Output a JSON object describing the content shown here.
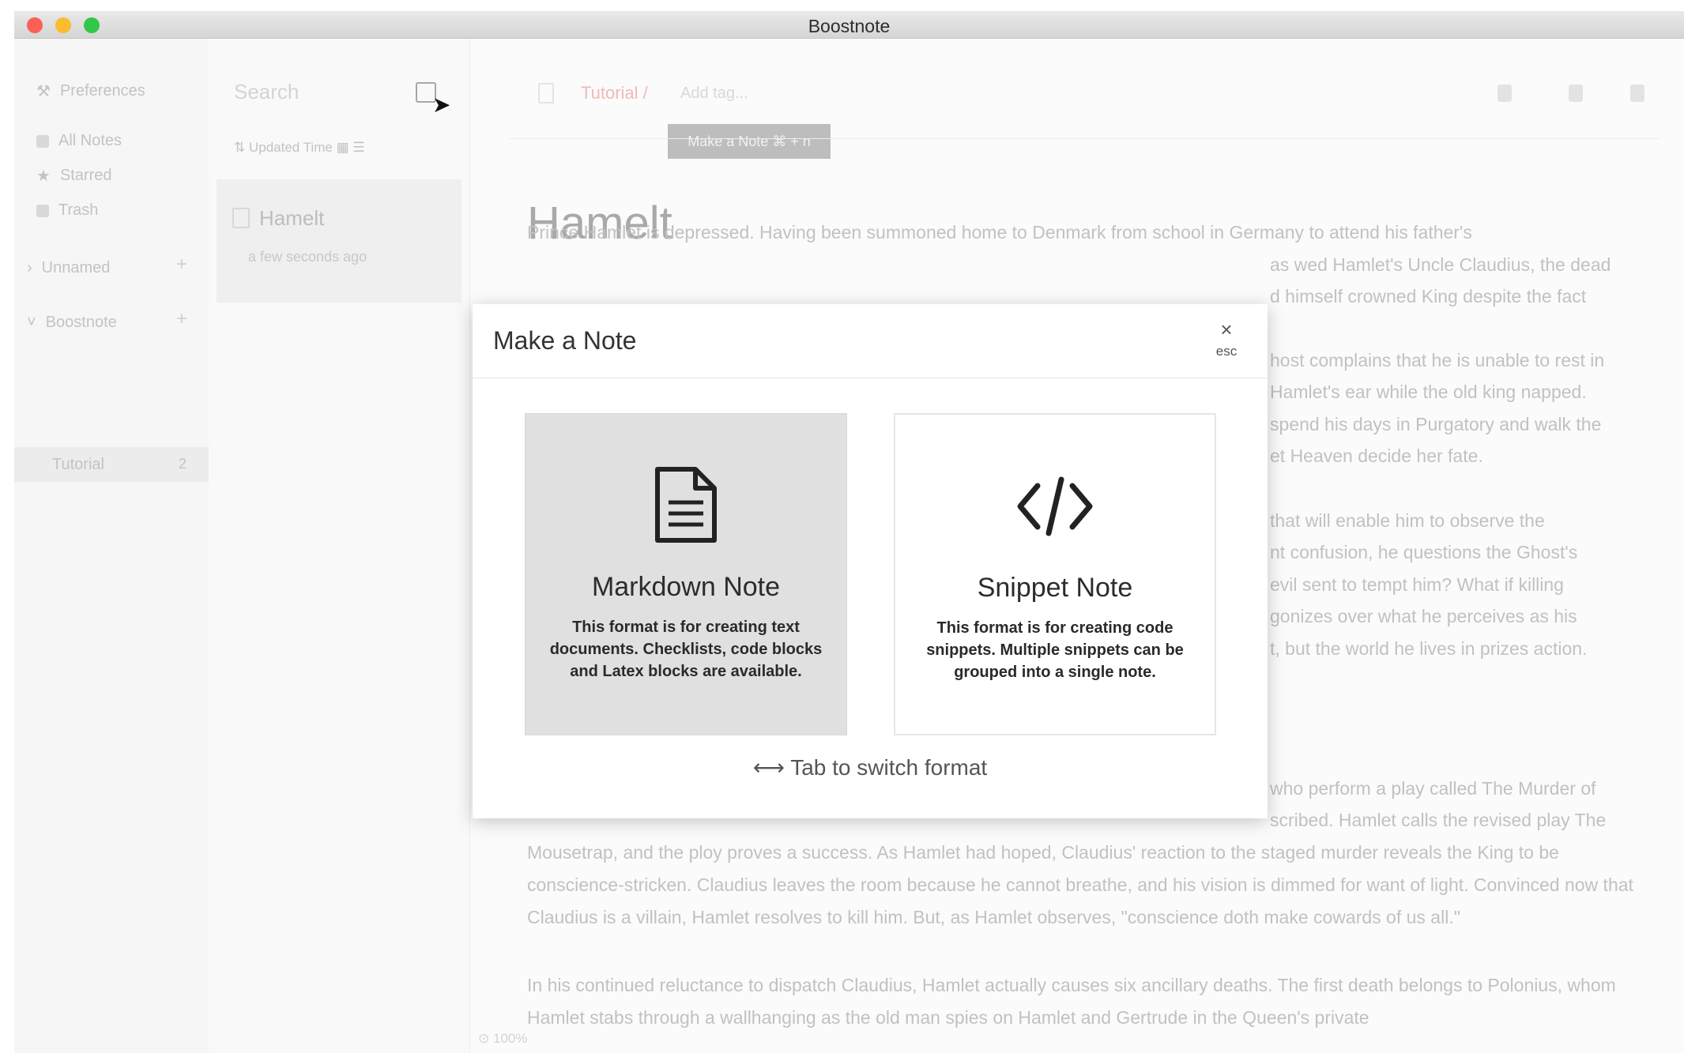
{
  "window": {
    "title": "Boostnote"
  },
  "sidebar": {
    "preferences": "Preferences",
    "items": [
      {
        "label": "All Notes",
        "icon": "grid-icon"
      },
      {
        "label": "Starred",
        "icon": "star-icon"
      },
      {
        "label": "Trash",
        "icon": "trash-icon"
      }
    ],
    "storages": [
      {
        "label": "Unnamed"
      },
      {
        "label": "Boostnote"
      }
    ],
    "folder": {
      "label": "Tutorial",
      "count": "2"
    }
  },
  "note_list": {
    "search_placeholder": "Search",
    "sort_label": "Updated Time",
    "notes": [
      {
        "title": "Hamelt",
        "time": "a few seconds ago"
      }
    ]
  },
  "editor": {
    "breadcrumb_folder": "Tutorial /",
    "add_tag_placeholder": "Add tag...",
    "tooltip": "Make a Note ⌘ + n",
    "doc_title": "Hamelt",
    "paragraphs": [
      "Prince Hamlet is depressed. Having been summoned home to Denmark from school in Germany to attend his father's",
      "Mousetrap, and the ploy proves a success. As Hamlet had hoped, Claudius' reaction to the staged murder reveals the King to be conscience-stricken. Claudius leaves the room because he cannot breathe, and his vision is dimmed for want of light. Convinced now that Claudius is a villain, Hamlet resolves to kill him. But, as Hamlet observes, \"conscience doth make cowards of us all.\"",
      "In his continued reluctance to dispatch Claudius, Hamlet actually causes six ancillary deaths. The first death belongs to Polonius, whom Hamlet stabs through a wallhanging as the old man spies on Hamlet and Gertrude in the Queen's private"
    ],
    "fragments": [
      "as wed Hamlet's Uncle Claudius, the dead",
      "d himself crowned King despite the fact",
      "host complains that he is unable to rest in",
      "Hamlet's ear while the old king napped.",
      "spend his days in Purgatory and walk the",
      "et Heaven decide her fate.",
      "that will enable him to observe the",
      "nt confusion, he questions the Ghost's",
      "evil sent to tempt him? What if killing",
      "gonizes over what he perceives as his",
      "t, but the world he lives in prizes action.",
      "who perform a play called The Murder of",
      "scribed. Hamlet calls the revised play The"
    ],
    "zoom": "100%"
  },
  "modal": {
    "title": "Make a Note",
    "close_symbol": "×",
    "close_hint": "esc",
    "options": [
      {
        "title": "Markdown Note",
        "description": "This format is for creating text documents. Checklists, code blocks and Latex blocks are available.",
        "icon": "document-icon"
      },
      {
        "title": "Snippet Note",
        "description": "This format is for creating code snippets. Multiple snippets can be grouped into a single note.",
        "icon": "code-icon"
      }
    ],
    "switch_hint": "⟷ Tab to switch format"
  }
}
